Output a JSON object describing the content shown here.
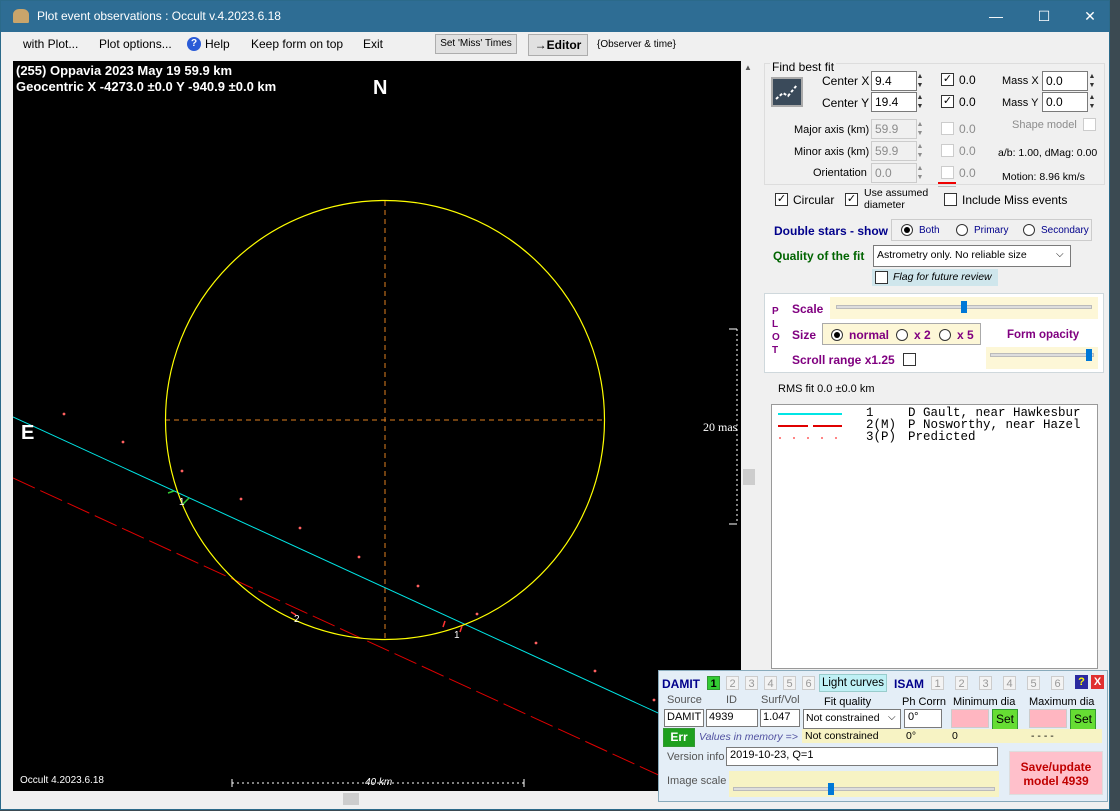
{
  "window": {
    "title": "Plot event observations : Occult v.4.2023.6.18"
  },
  "menu": {
    "with_plot": "with Plot...",
    "plot_options": "Plot options...",
    "help": "Help",
    "keep_on_top": "Keep form on top",
    "exit": "Exit",
    "set_miss": "Set 'Miss' Times",
    "editor": "→Editor",
    "observer_time": "{Observer & time}"
  },
  "plot": {
    "title": "(255) Oppavia  2023 May 19   59.9 km",
    "geocentric": "Geocentric  X  -4273.0 ±0.0  Y -940.9 ±0.0 km",
    "north": "N",
    "east": "E",
    "scale_mas": "20 mas",
    "scale_km": "40 km",
    "version": "Occult 4.2023.6.18",
    "chord_labels": [
      "1",
      "2",
      "1"
    ]
  },
  "fit": {
    "group_title": "Find best fit",
    "center_x_label": "Center X",
    "center_x": "9.4",
    "center_x_val": "0.0",
    "center_y_label": "Center Y",
    "center_y": "19.4",
    "center_y_val": "0.0",
    "mass_x_label": "Mass X",
    "mass_x": "0.0",
    "mass_y_label": "Mass Y",
    "mass_y": "0.0",
    "major_label": "Major axis (km)",
    "major": "59.9",
    "major_val": "0.0",
    "minor_label": "Minor axis (km)",
    "minor": "59.9",
    "minor_val": "0.0",
    "orient_label": "Orientation",
    "orient": "0.0",
    "orient_val": "0.0",
    "shape_model": "Shape model",
    "ab": "a/b: 1.00, dMag: 0.00",
    "motion": "Motion: 8.96 km/s",
    "circular": "Circular",
    "assumed": "Use assumed diameter",
    "include_miss": "Include Miss events"
  },
  "double": {
    "label": "Double stars - show",
    "both": "Both",
    "primary": "Primary",
    "secondary": "Secondary"
  },
  "quality": {
    "label": "Quality of the fit",
    "value": "Astrometry only. No reliable size",
    "flag": "Flag for future review"
  },
  "plotpanel": {
    "letters": [
      "P",
      "L",
      "O",
      "T"
    ],
    "scale": "Scale",
    "size": "Size",
    "normal": "normal",
    "x2": "x 2",
    "x5": "x 5",
    "form_opacity": "Form opacity",
    "scroll_range": "Scroll range x1.25"
  },
  "rms": "RMS fit 0.0 ±0.0 km",
  "legend": [
    {
      "num": "1",
      "text": "D Gault, near Hawkesbur"
    },
    {
      "num": "2(M)",
      "text": "P Nosworthy, near Hazel"
    },
    {
      "num": "3(P)",
      "text": "Predicted"
    }
  ],
  "damit": {
    "damit": "DAMIT",
    "isam": "ISAM",
    "nums": [
      "1",
      "2",
      "3",
      "4",
      "5",
      "6"
    ],
    "light_curves": "Light curves",
    "help": "?",
    "close": "X",
    "source_label": "Source",
    "id_label": "ID",
    "surf_label": "Surf/Vol",
    "source": "DAMIT",
    "id": "4939",
    "surf": "1.047",
    "fit_quality_label": "Fit quality",
    "fit_quality": "Not constrained",
    "fit_quality2": "Not constrained",
    "ph_corr_label": "Ph Corrn",
    "ph_corr": "0°",
    "ph_corr2": "0°",
    "min_dia_label": "Minimum dia",
    "min_dia2": "0",
    "max_dia_label": "Maximum dia",
    "max_dia2": "- - - -",
    "set": "Set",
    "err": "Err",
    "values_mem": "Values in memory =>",
    "version_label": "Version info",
    "version": "2019-10-23, Q=1",
    "image_scale": "Image scale",
    "save": "Save/update model 4939"
  }
}
